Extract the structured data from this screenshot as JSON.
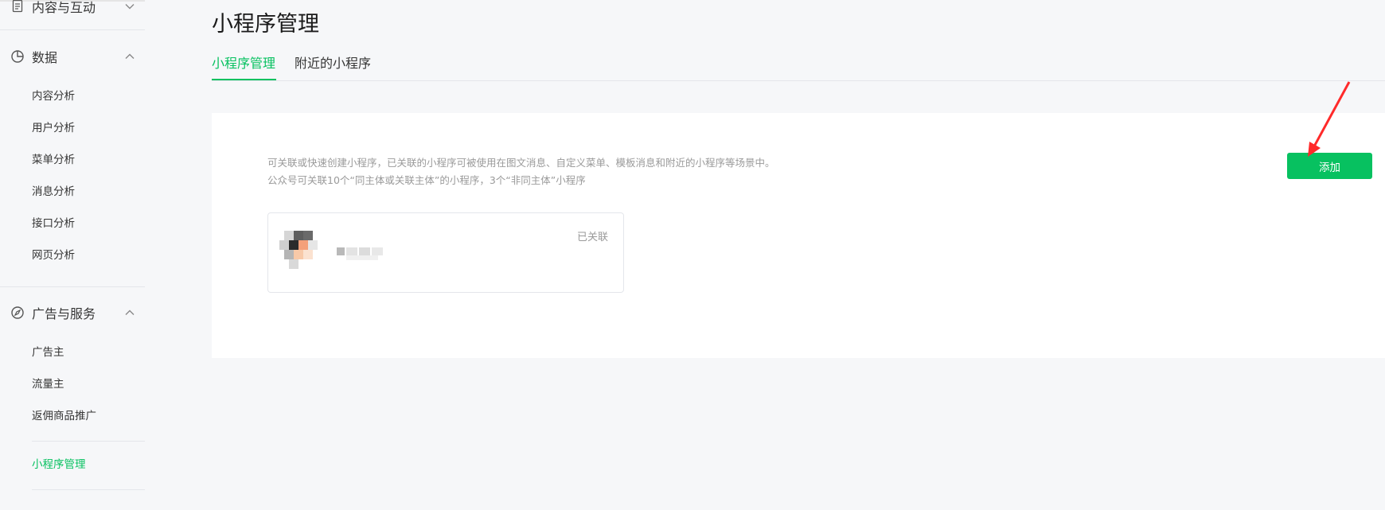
{
  "sidebar": {
    "sections": [
      {
        "title": "内容与互动",
        "icon": "document-icon",
        "expanded": false
      },
      {
        "title": "数据",
        "icon": "pie-chart-icon",
        "expanded": true,
        "items": [
          "内容分析",
          "用户分析",
          "菜单分析",
          "消息分析",
          "接口分析",
          "网页分析"
        ]
      },
      {
        "title": "广告与服务",
        "icon": "compass-icon",
        "expanded": true,
        "items": [
          "广告主",
          "流量主",
          "返佣商品推广",
          "小程序管理"
        ]
      }
    ],
    "active_item": "小程序管理"
  },
  "page": {
    "title": "小程序管理",
    "tabs": [
      "小程序管理",
      "附近的小程序"
    ],
    "active_tab": "小程序管理"
  },
  "panel": {
    "description_line1": "可关联或快速创建小程序，已关联的小程序可被使用在图文消息、自定义菜单、模板消息和附近的小程序等场景中。",
    "description_line2": "公众号可关联10个“同主体或关联主体”的小程序，3个“非同主体”小程序",
    "add_button": "添加",
    "card": {
      "status": "已关联"
    }
  },
  "colors": {
    "accent": "#07c160",
    "annotation_arrow": "#ff2a2a",
    "muted_text": "#9a9a9a"
  }
}
